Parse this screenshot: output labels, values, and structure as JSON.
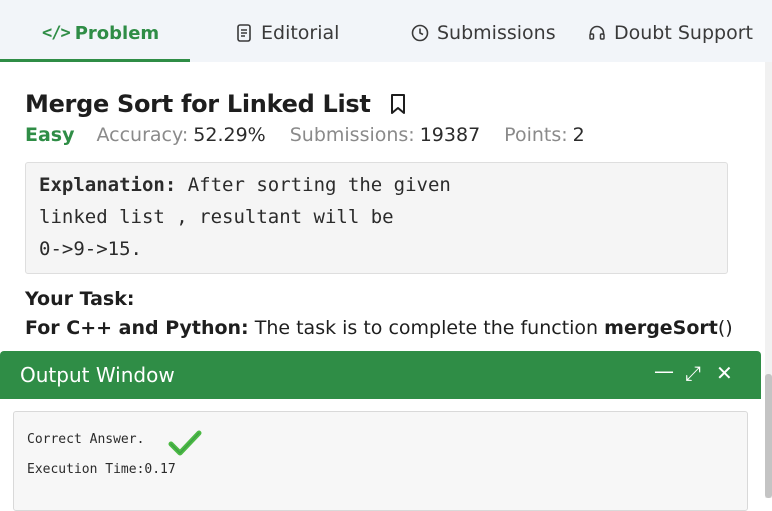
{
  "tabs": {
    "problem": {
      "code_glyph": "</>",
      "label": "Problem"
    },
    "editorial": {
      "label": "Editorial",
      "icon": "document-icon"
    },
    "submissions": {
      "label": "Submissions",
      "icon": "clock-icon"
    },
    "doubt": {
      "label": "Doubt Support",
      "icon": "headset-icon"
    }
  },
  "problem": {
    "title": "Merge Sort for Linked List",
    "difficulty": "Easy",
    "accuracy_label": "Accuracy:",
    "accuracy_value": "52.29%",
    "submissions_label": "Submissions:",
    "submissions_value": "19387",
    "points_label": "Points:",
    "points_value": "2"
  },
  "explanation": {
    "label": "Explanation:",
    "line1": "After sorting the given",
    "line2": "linked list , resultant will be",
    "line3": "0->9->15."
  },
  "task": {
    "heading": "Your Task:",
    "lang_label": "For C++ and Python:",
    "text": "The task is to complete the function",
    "function_name": "mergeSort",
    "parens": "()"
  },
  "output": {
    "title": "Output Window",
    "minimize": "—",
    "expand": "⤢",
    "close": "✕",
    "result": "Correct Answer.",
    "time": "Execution Time:0.17"
  },
  "colors": {
    "brand": "#2f8d46",
    "check": "#4cb944"
  }
}
